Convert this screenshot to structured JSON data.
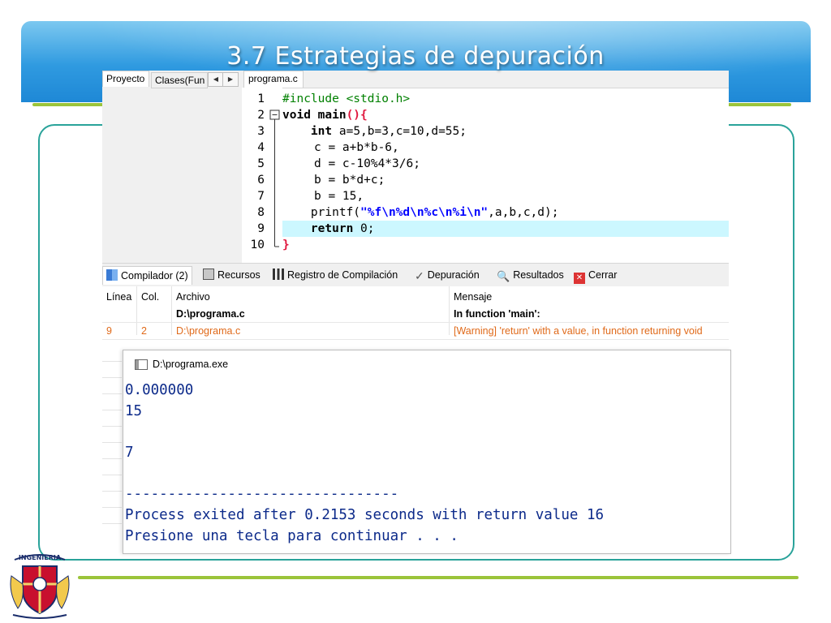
{
  "slide": {
    "title": "3.7  Estrategias de depuración",
    "logo_text": "INGENIERIA",
    "colors": {
      "banner": "#2f9ae0",
      "rule": "#9bc43a",
      "frame": "#2aa39a"
    }
  },
  "ide": {
    "left_tabs": [
      "Proyecto",
      "Clases(Fun"
    ],
    "file_tab": "programa.c",
    "code_lines": [
      {
        "n": "1",
        "html_key": "l1"
      },
      {
        "n": "2"
      },
      {
        "n": "3"
      },
      {
        "n": "4"
      },
      {
        "n": "5"
      },
      {
        "n": "6"
      },
      {
        "n": "7"
      },
      {
        "n": "8"
      },
      {
        "n": "9"
      },
      {
        "n": "10"
      }
    ],
    "code": {
      "l1": "#include <stdio.h>",
      "l2a": "void",
      "l2b": " main",
      "l3a": "int",
      "l3b": " a=5,b=3,c=10,d=55;",
      "l4": "c = a+b*b-6,",
      "l5": "d = c-10%4*3/6;",
      "l6": "b = b*d+c;",
      "l7": "b = 15,",
      "l8a": "printf(",
      "l8b": "\"%f\\n%d\\n%c\\n%i\\n\"",
      "l8c": ",a,b,c,d);",
      "l9a": "return",
      "l9b": " 0;",
      "l10": "}"
    },
    "bottom_tabs": [
      "Compilador (2)",
      "Recursos",
      "Registro de Compilación",
      "Depuración",
      "Resultados",
      "Cerrar"
    ],
    "table": {
      "headers": [
        "Línea",
        "Col.",
        "Archivo",
        "Mensaje"
      ],
      "rows": [
        {
          "linea": "",
          "col": "",
          "archivo": "D:\\programa.c",
          "mensaje": "In function 'main':"
        },
        {
          "linea": "9",
          "col": "2",
          "archivo": "D:\\programa.c",
          "mensaje": "[Warning] 'return' with a value, in function returning void"
        }
      ]
    }
  },
  "console": {
    "title": "D:\\programa.exe",
    "lines": [
      "0.000000",
      "15",
      "",
      "7",
      "",
      "--------------------------------",
      "Process exited after 0.2153 seconds with return value 16",
      "Presione una tecla para continuar . . ."
    ]
  }
}
